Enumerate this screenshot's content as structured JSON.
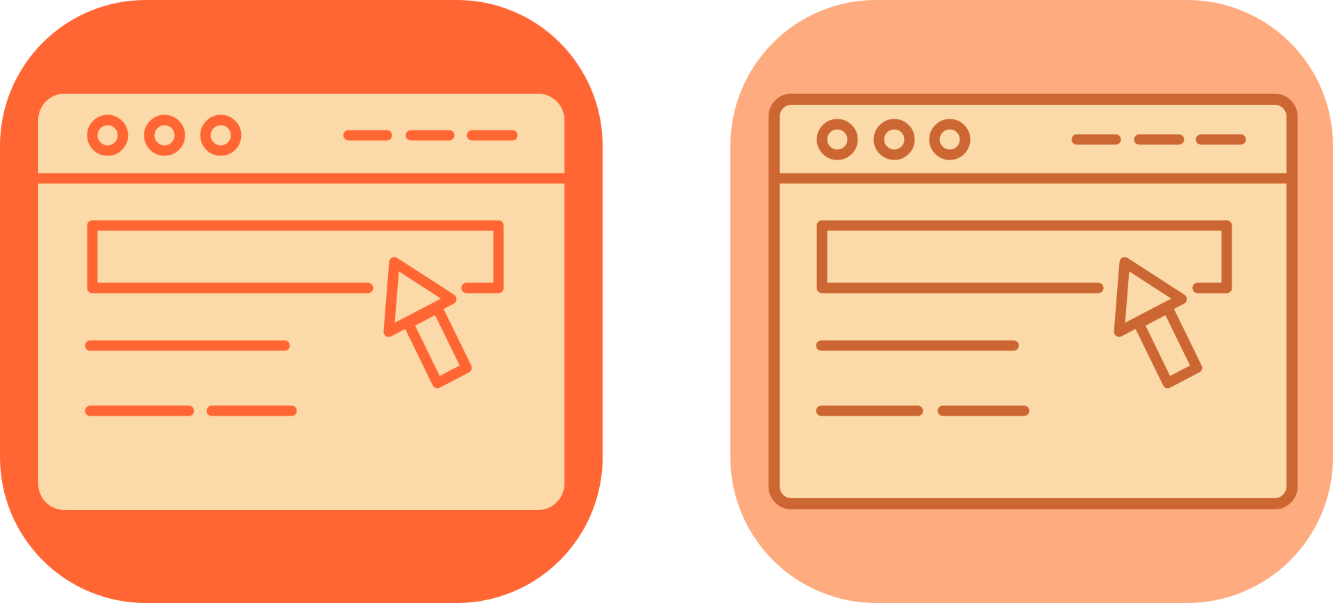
{
  "icons": [
    {
      "name": "browser-search-click-icon-filled",
      "style": "filled",
      "tile_color": "#FF6633",
      "window_fill": "#FCD9A8",
      "stroke_color": "#FF6633"
    },
    {
      "name": "browser-search-click-icon-lineal",
      "style": "lineal-color",
      "tile_color": "#FFAB80",
      "window_fill": "#FCD9A8",
      "stroke_color": "#CC6633"
    }
  ]
}
